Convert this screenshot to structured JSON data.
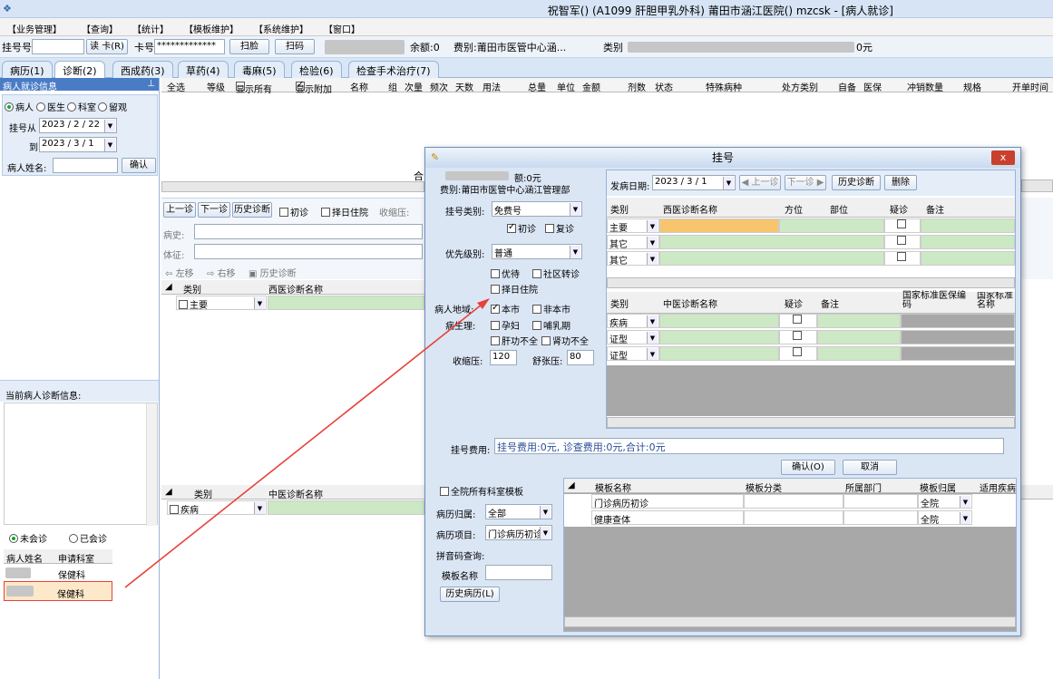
{
  "window": {
    "title": "祝智军() (A1099 肝胆甲乳外科) 莆田市涵江医院() mzcsk - [病人就诊]"
  },
  "menu": [
    "【业务管理】",
    "【查询】",
    "【统计】",
    "【模板维护】",
    "【系统维护】",
    "【窗口】"
  ],
  "toolbar": {
    "reg_no_label": "挂号号",
    "read_card": "读 卡(R)",
    "card_no_label": "卡号",
    "card_no_value": "*************",
    "scan_check": "扫脸",
    "scan_code": "扫码",
    "balance": "余额:0",
    "fee_type": "费别:莆田市医管中心涵...",
    "category_label": "类别",
    "amount_suffix": "0元"
  },
  "tabs": [
    "病历(1)",
    "诊断(2)",
    "西成药(3)",
    "草药(4)",
    "毒麻(5)",
    "检验(6)",
    "检查手术治疗(7)"
  ],
  "left_panel": {
    "header": "病人就诊信息",
    "pin": "ª",
    "radios": [
      "病人",
      "医生",
      "科室",
      "留观"
    ],
    "reg_from_label": "挂号从",
    "reg_from": "2023 / 2 / 22",
    "reg_to_label": "到",
    "reg_to": "2023 / 3 / 1",
    "name_label": "病人姓名:",
    "confirm": "确认",
    "current_diag_label": "当前病人诊断信息:",
    "visit_radios": [
      "未会诊",
      "已会诊"
    ],
    "patient_cols": [
      "病人姓名",
      "申请科室"
    ],
    "patients": [
      {
        "dept": "保健科"
      },
      {
        "dept": "保健科"
      }
    ]
  },
  "main_grid": {
    "select_all": "全选",
    "headers": [
      "等级",
      "显示所有",
      "显示附加",
      "名称",
      "组",
      "次量",
      "频次",
      "天数",
      "用法",
      "总量",
      "单位",
      "金额",
      "剂数",
      "状态",
      "特殊病种",
      "处方类别",
      "自备",
      "医保",
      "冲销数量",
      "规格",
      "开单时间"
    ]
  },
  "mid_left": {
    "prev": "上一诊",
    "next": "下一诊",
    "history": "历史诊断",
    "first": "初诊",
    "select_day": "择日住院",
    "systolic": "收缩压:",
    "history_label": "病史:",
    "sign_label": "体征:",
    "move_left": "左移",
    "move_right": "右移",
    "history_diag": "历史诊断",
    "west_cols": [
      "类别",
      "西医诊断名称"
    ],
    "west_row": "主要",
    "chinese_cols": [
      "类别",
      "中医诊断名称"
    ],
    "chinese_row": "疾病",
    "combine": "合"
  },
  "dialog": {
    "title": "挂号",
    "close": "x",
    "amount": "额:0元",
    "fee_type": "费别:莆田市医管中心涵江管理部",
    "reg_category_label": "挂号类别:",
    "reg_category": "免费号",
    "first_visit": "初诊",
    "return_visit": "复诊",
    "priority_label": "优先级别:",
    "priority": "普通",
    "priority_vip": "优待",
    "community": "社区转诊",
    "select_day": "择日住院",
    "region_label": "病人地域:",
    "local": "本市",
    "nonlocal": "非本市",
    "physio_label": "病生理:",
    "pregnant": "孕妇",
    "lactation": "哺乳期",
    "liver": "肝功不全",
    "kidney": "肾功不全",
    "systolic_label": "收缩压:",
    "systolic": "120",
    "diastolic_label": "舒张压:",
    "diastolic": "80",
    "visit_date_label": "发病日期:",
    "visit_date": "2023 / 3 / 1",
    "prev": "上一诊",
    "next": "下一诊",
    "history": "历史诊断",
    "delete": "删除",
    "west_headers": [
      "类别",
      "西医诊断名称",
      "方位",
      "部位",
      "疑诊",
      "备注"
    ],
    "west_rows": [
      "主要",
      "其它",
      "其它"
    ],
    "chn_headers": [
      "类别",
      "中医诊断名称",
      "疑诊",
      "备注",
      "国家标准医保编码",
      "国家标准名称"
    ],
    "chn_rows": [
      "疾病",
      "证型",
      "证型"
    ],
    "fee_label": "挂号费用:",
    "fee_value": "挂号费用:0元, 诊查费用:0元,合计:0元",
    "ok": "确认(O)",
    "cancel": "取消",
    "tmpl_all": "全院所有科室模板",
    "tmpl_owner_label": "病历归属:",
    "tmpl_owner": "全部",
    "tmpl_item_label": "病历项目:",
    "tmpl_item": "门诊病历初诊",
    "pinyin_label": "拼音码查询:",
    "tmpl_name_label": "模板名称",
    "history_record": "历史病历(L)",
    "tmpl_headers": [
      "模板名称",
      "模板分类",
      "所属部门",
      "模板归属",
      "适用疾病"
    ],
    "tmpl_rows": [
      {
        "name": "门诊病历初诊",
        "owner": "全院"
      },
      {
        "name": "健康查体",
        "owner": "全院"
      }
    ]
  },
  "colors": {
    "accent": "#4a7cc6",
    "annotation": "#e8413a",
    "green_cell": "#cce8c4",
    "orange_cell": "#f6c56e"
  }
}
